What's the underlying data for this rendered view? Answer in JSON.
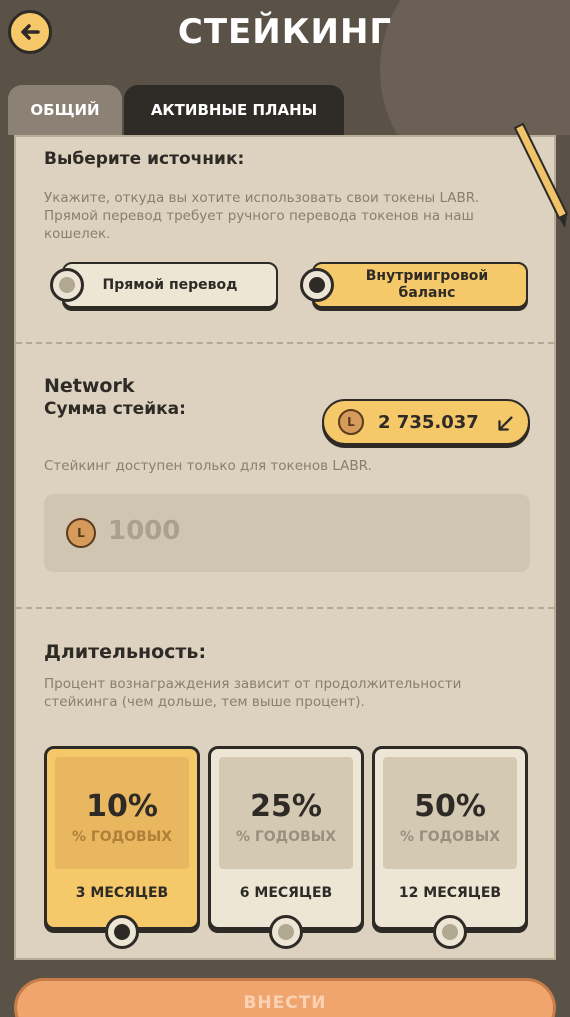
{
  "header": {
    "title": "СТЕЙКИНГ"
  },
  "tabs": [
    {
      "label": "ОБЩИЙ"
    },
    {
      "label": "АКТИВНЫЕ ПЛАНЫ"
    }
  ],
  "source": {
    "title": "Выберите источник:",
    "description": "Укажите, откуда вы хотите использовать свои токены LABR. Прямой перевод требует ручного перевода токенов на наш кошелек.",
    "options": [
      {
        "label": "Прямой перевод",
        "selected": false
      },
      {
        "label": "Внутриигровой баланс",
        "selected": true
      }
    ]
  },
  "stake": {
    "network_label": "Network",
    "amount_label": "Сумма стейка:",
    "balance": "2 735.037",
    "note": "Стейкинг доступен только для токенов LABR.",
    "input_placeholder": "1000",
    "coin_glyph": "L"
  },
  "duration": {
    "title": "Длительность:",
    "description": "Процент вознаграждения зависит от продолжительности стейкинга (чем дольше, тем выше процент).",
    "plans": [
      {
        "percent": "10%",
        "unit": "% ГОДОВЫХ",
        "months": "3 МЕСЯЦЕВ",
        "selected": true
      },
      {
        "percent": "25%",
        "unit": "% ГОДОВЫХ",
        "months": "6 МЕСЯЦЕВ",
        "selected": false
      },
      {
        "percent": "50%",
        "unit": "% ГОДОВЫХ",
        "months": "12 МЕСЯЦЕВ",
        "selected": false
      }
    ]
  },
  "submit_label": "ВНЕСТИ",
  "colors": {
    "accent": "#f5c86a",
    "dark": "#2e2a26",
    "panel": "#dcd2bf",
    "submit": "#f0a46e"
  }
}
